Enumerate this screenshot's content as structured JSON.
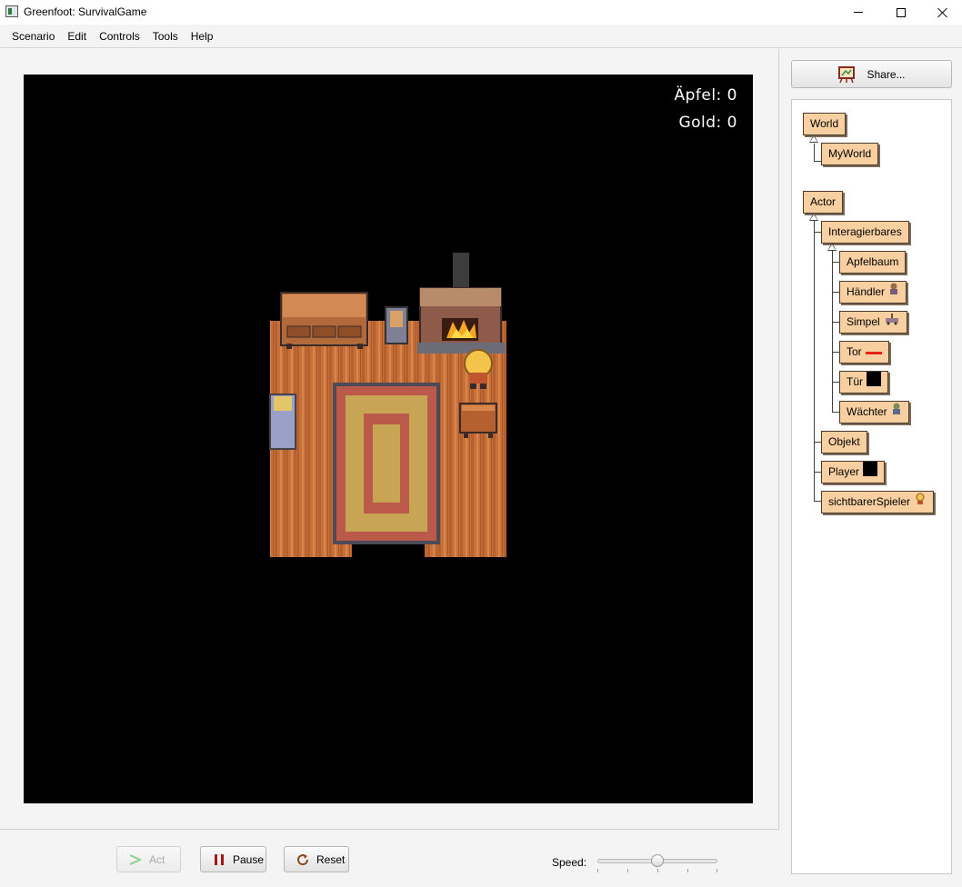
{
  "window": {
    "title": "Greenfoot: SurvivalGame"
  },
  "menu": {
    "items": [
      "Scenario",
      "Edit",
      "Controls",
      "Tools",
      "Help"
    ]
  },
  "world": {
    "apples_label": "Äpfel: 0",
    "gold_label": "Gold: 0",
    "background_color": "#000000"
  },
  "controls": {
    "act_label": "Act",
    "pause_label": "Pause",
    "reset_label": "Reset",
    "speed_label": "Speed:",
    "speed_value": 0.5
  },
  "share": {
    "label": "Share..."
  },
  "class_tree": {
    "world_root": "World",
    "world_classes": [
      "MyWorld"
    ],
    "actor_root": "Actor",
    "interagierbares": "Interagierbares",
    "interagierbares_children": [
      {
        "name": "Apfelbaum",
        "icon": "none"
      },
      {
        "name": "Händler",
        "icon": "merchant-sprite-icon"
      },
      {
        "name": "Simpel",
        "icon": "cart-sprite-icon"
      },
      {
        "name": "Tor",
        "icon": "red-line-icon"
      },
      {
        "name": "Tür",
        "icon": "black-square-icon"
      },
      {
        "name": "Wächter",
        "icon": "guard-sprite-icon"
      }
    ],
    "objekt": "Objekt",
    "player": "Player",
    "sichtbarer_spieler": "sichtbarerSpieler",
    "class_color": "#f7cfa0"
  }
}
